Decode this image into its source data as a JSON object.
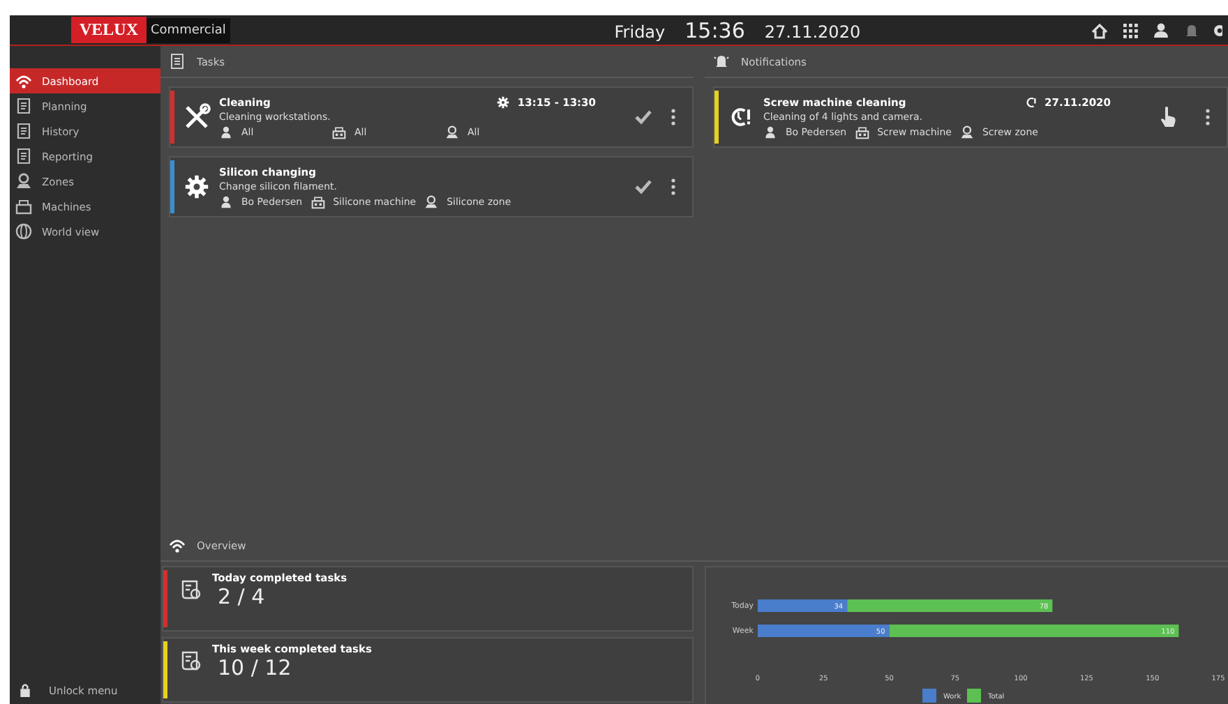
{
  "header": {
    "logo": "VELUX",
    "product": "Commercial",
    "day": "Friday",
    "time": "15:36",
    "date": "27.11.2020"
  },
  "sidebar": {
    "items": [
      {
        "label": "Dashboard",
        "selected": true
      },
      {
        "label": "Planning",
        "selected": false
      },
      {
        "label": "History",
        "selected": false
      },
      {
        "label": "Reporting",
        "selected": false
      },
      {
        "label": "Zones",
        "selected": false
      },
      {
        "label": "Machines",
        "selected": false
      },
      {
        "label": "World view",
        "selected": false
      }
    ],
    "footer": "Unlock menu"
  },
  "tasks": {
    "title": "Tasks",
    "items": [
      {
        "kind": "tools",
        "title": "Cleaning",
        "description": "Cleaning workstations.",
        "time": "13:15 - 13:30",
        "color": "#d32f2f",
        "assignee": "All",
        "machine": "All",
        "zone": "All"
      },
      {
        "kind": "gear",
        "title": "Silicon changing",
        "description": "Change silicon filament.",
        "color": "#3b8fd0",
        "assignee": "Bo Pedersen",
        "machine": "Silicone machine",
        "zone": "Silicone zone"
      }
    ]
  },
  "notifications": {
    "title": "Notifications",
    "items": [
      {
        "title": "Screw machine cleaning",
        "description": "Cleaning of 4 lights and camera.",
        "date": "27.11.2020",
        "color": "#e6d21e",
        "assignee": "Bo Pedersen",
        "machine": "Screw machine",
        "zone": "Screw zone"
      }
    ]
  },
  "overview": {
    "title": "Overview",
    "stats": [
      {
        "label": "Today completed tasks",
        "value": "2 / 4",
        "color": "#d32f2f"
      },
      {
        "label": "This week completed tasks",
        "value": "10 / 12",
        "color": "#e6d21e"
      }
    ],
    "chart_data": {
      "type": "bar",
      "orientation": "horizontal",
      "stacked": true,
      "categories": [
        "Today",
        "Week"
      ],
      "series": [
        {
          "name": "Work",
          "color": "#4a7dcc",
          "values": [
            34,
            50
          ]
        },
        {
          "name": "Total",
          "color": "#5cc152",
          "values": [
            78,
            110
          ]
        }
      ],
      "xlim": [
        0,
        175
      ],
      "xticks": [
        0,
        25,
        50,
        75,
        100,
        125,
        150,
        175
      ],
      "data_labels": true,
      "legend": "bottom"
    }
  }
}
